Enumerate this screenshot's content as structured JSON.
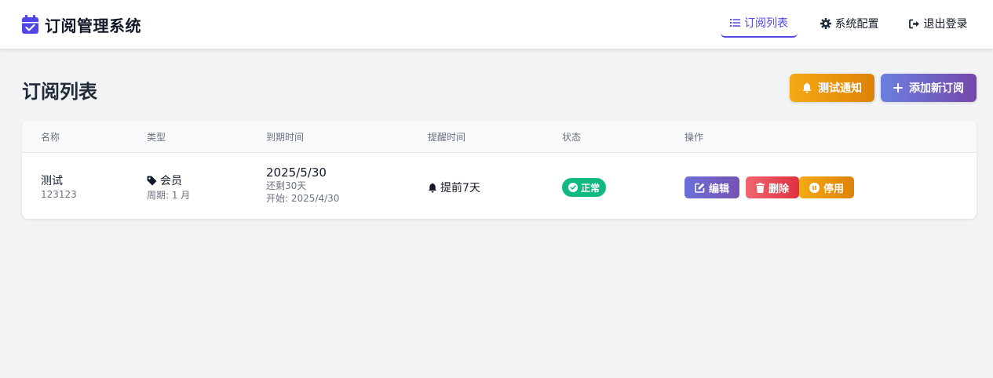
{
  "navbar": {
    "brand_title": "订阅管理系统",
    "items": [
      {
        "label": "订阅列表",
        "icon": "list-icon",
        "active": true
      },
      {
        "label": "系统配置",
        "icon": "gear-icon",
        "active": false
      },
      {
        "label": "退出登录",
        "icon": "logout-icon",
        "active": false
      }
    ]
  },
  "page": {
    "title": "订阅列表",
    "test_notify_label": "测试通知",
    "add_label": "添加新订阅"
  },
  "table": {
    "headers": [
      "名称",
      "类型",
      "到期时间",
      "提醒时间",
      "状态",
      "操作"
    ],
    "rows": [
      {
        "name": "测试",
        "note": "123123",
        "type": "会员",
        "cycle": "周期: 1 月",
        "expire": "2025/5/30",
        "remaining": "还剩30天",
        "start": "开始: 2025/4/30",
        "reminder": "提前7天",
        "status": "正常",
        "actions": {
          "edit": "编辑",
          "delete": "删除",
          "disable": "停用"
        }
      }
    ]
  },
  "colors": {
    "accent": "#4f46e5",
    "status_ok": "#10b981",
    "warning": "#f59e0b",
    "danger": "#ef4444"
  }
}
